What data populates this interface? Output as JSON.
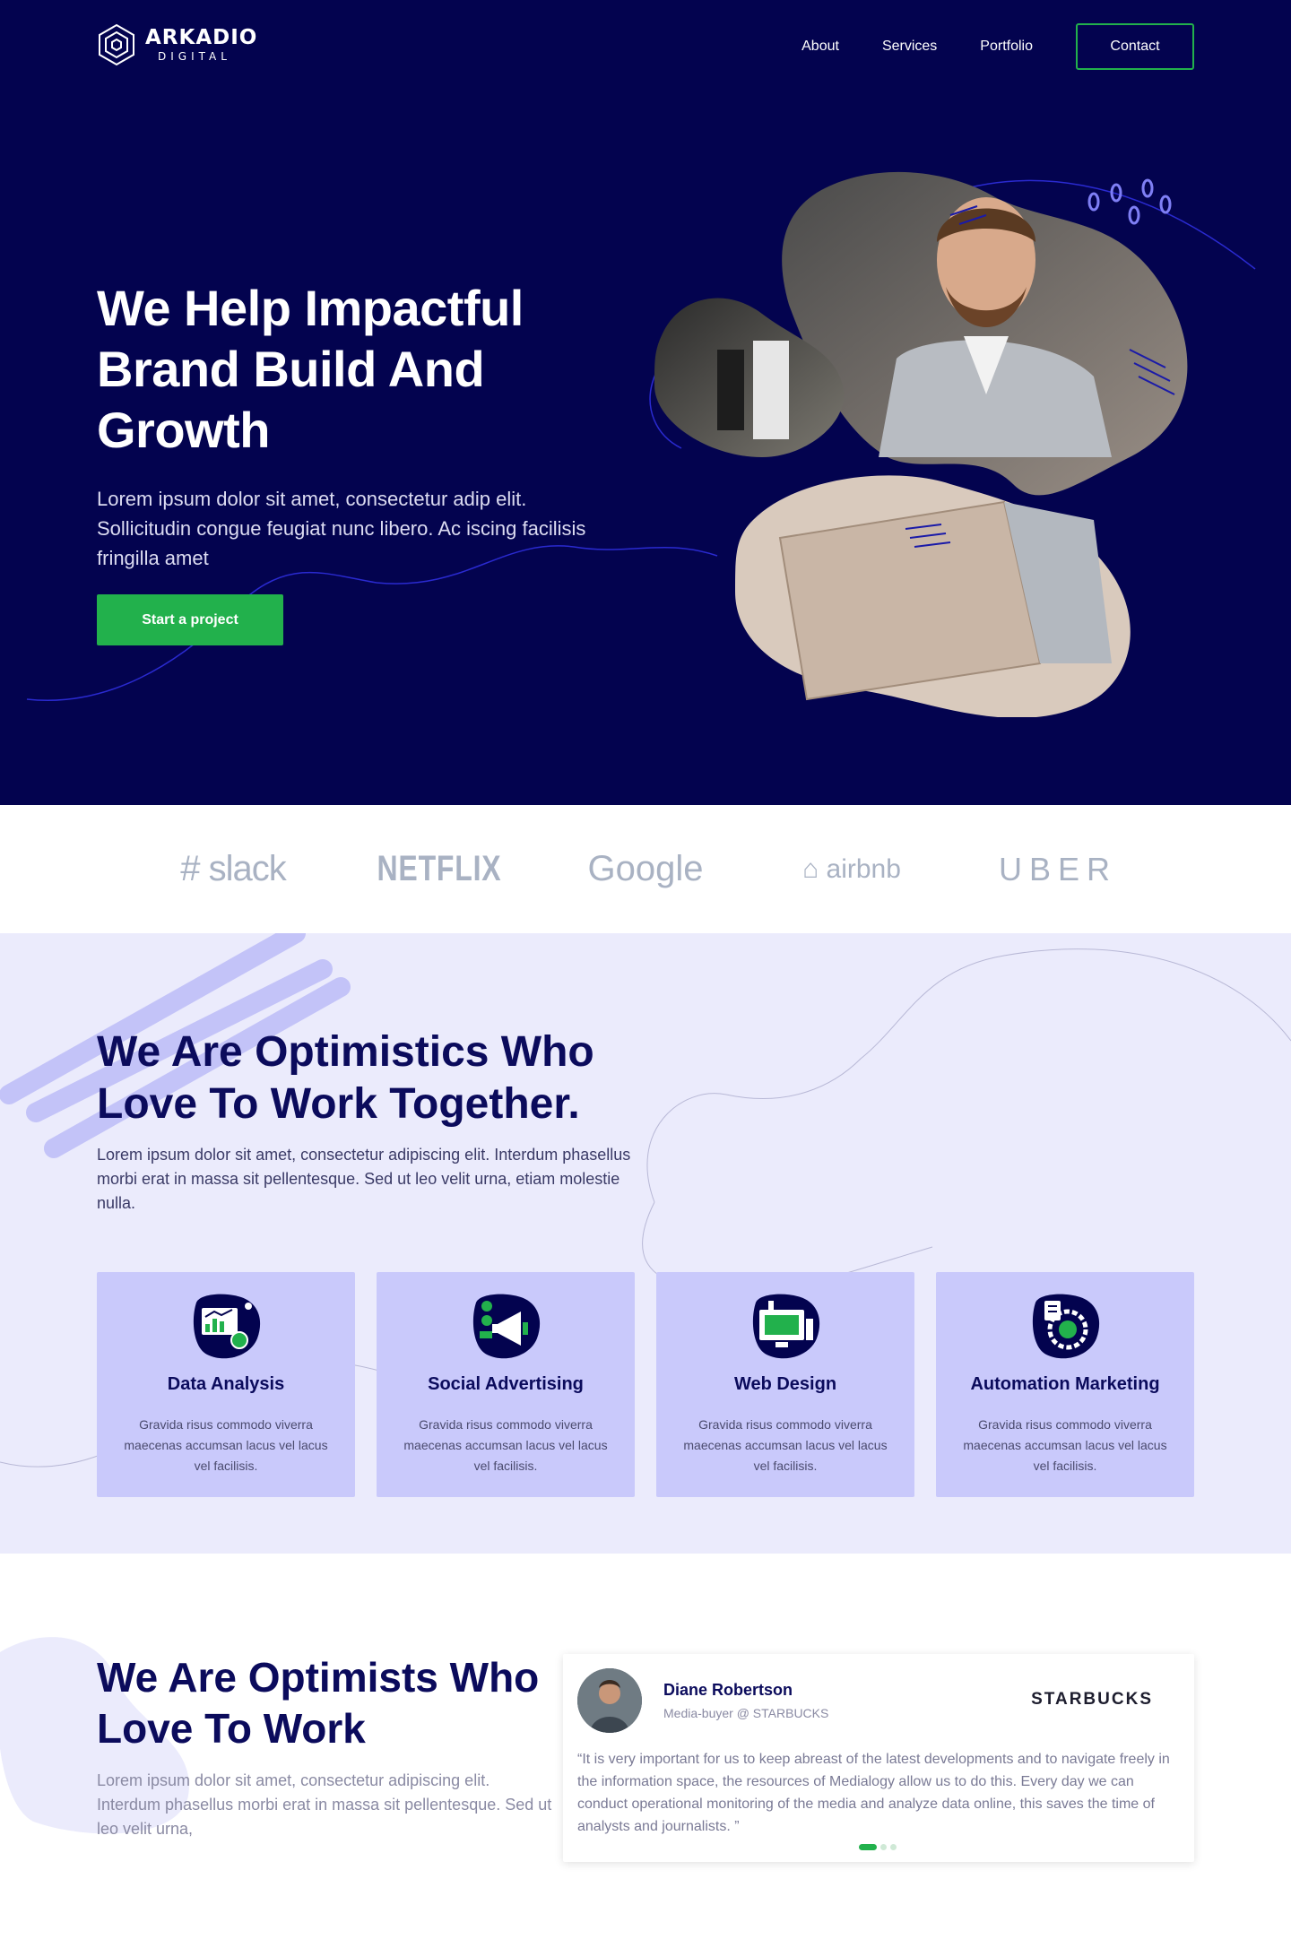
{
  "brand": {
    "name": "ARKADIO",
    "sub": "DIGITAL"
  },
  "nav": {
    "items": [
      {
        "label": "About"
      },
      {
        "label": "Services"
      },
      {
        "label": "Portfolio"
      }
    ],
    "contact_label": "Contact"
  },
  "hero": {
    "title": "We Help Impactful Brand Build And Growth",
    "text": "Lorem ipsum dolor sit amet, consectetur adip elit. Sollicitudin congue feugiat nunc libero. Ac iscing facilisis fringilla amet",
    "cta_label": "Start a project"
  },
  "brands": {
    "items": [
      {
        "label": "slack"
      },
      {
        "label": "NETFLIX"
      },
      {
        "label": "Google"
      },
      {
        "label": "airbnb"
      },
      {
        "label": "UBER"
      }
    ]
  },
  "about": {
    "title": "We Are Optimistics Who Love To Work Together.",
    "text": "Lorem ipsum dolor sit amet, consectetur adipiscing elit. Interdum phasellus morbi erat in massa sit pellentesque. Sed ut leo velit urna, etiam molestie nulla."
  },
  "services": [
    {
      "title": "Data Analysis",
      "text": "Gravida risus commodo viverra maecenas accumsan lacus vel lacus vel facilisis.",
      "icon": "data-analysis-icon"
    },
    {
      "title": "Social Advertising",
      "text": "Gravida risus commodo viverra maecenas accumsan lacus vel lacus vel facilisis.",
      "icon": "megaphone-icon"
    },
    {
      "title": "Web Design",
      "text": "Gravida risus commodo viverra maecenas accumsan lacus vel lacus vel facilisis.",
      "icon": "web-design-icon"
    },
    {
      "title": "Automation Marketing",
      "text": "Gravida risus commodo viverra maecenas accumsan lacus vel lacus vel facilisis.",
      "icon": "automation-gear-icon"
    }
  ],
  "testimonial_section": {
    "title": "We Are Optimists Who Love To Work",
    "text": "Lorem ipsum dolor sit amet, consectetur adipiscing elit. Interdum phasellus morbi erat in massa sit pellentesque. Sed ut leo velit urna,"
  },
  "testimonial": {
    "name": "Diane Robertson",
    "role": "Media-buyer @ STARBUCKS",
    "company": "STARBUCKS",
    "quote": "“It is very important for us to keep abreast of the latest developments and to navigate freely in the information space, the resources of Medialogy allow us to do this. Every day we can conduct operational monitoring of the media and analyze data online, this saves the time of analysts and journalists. ”"
  },
  "colors": {
    "hero_bg": "#03034f",
    "accent": "#22b14c",
    "about_bg": "#ebebfc",
    "card_bg": "#c9c9fb"
  }
}
